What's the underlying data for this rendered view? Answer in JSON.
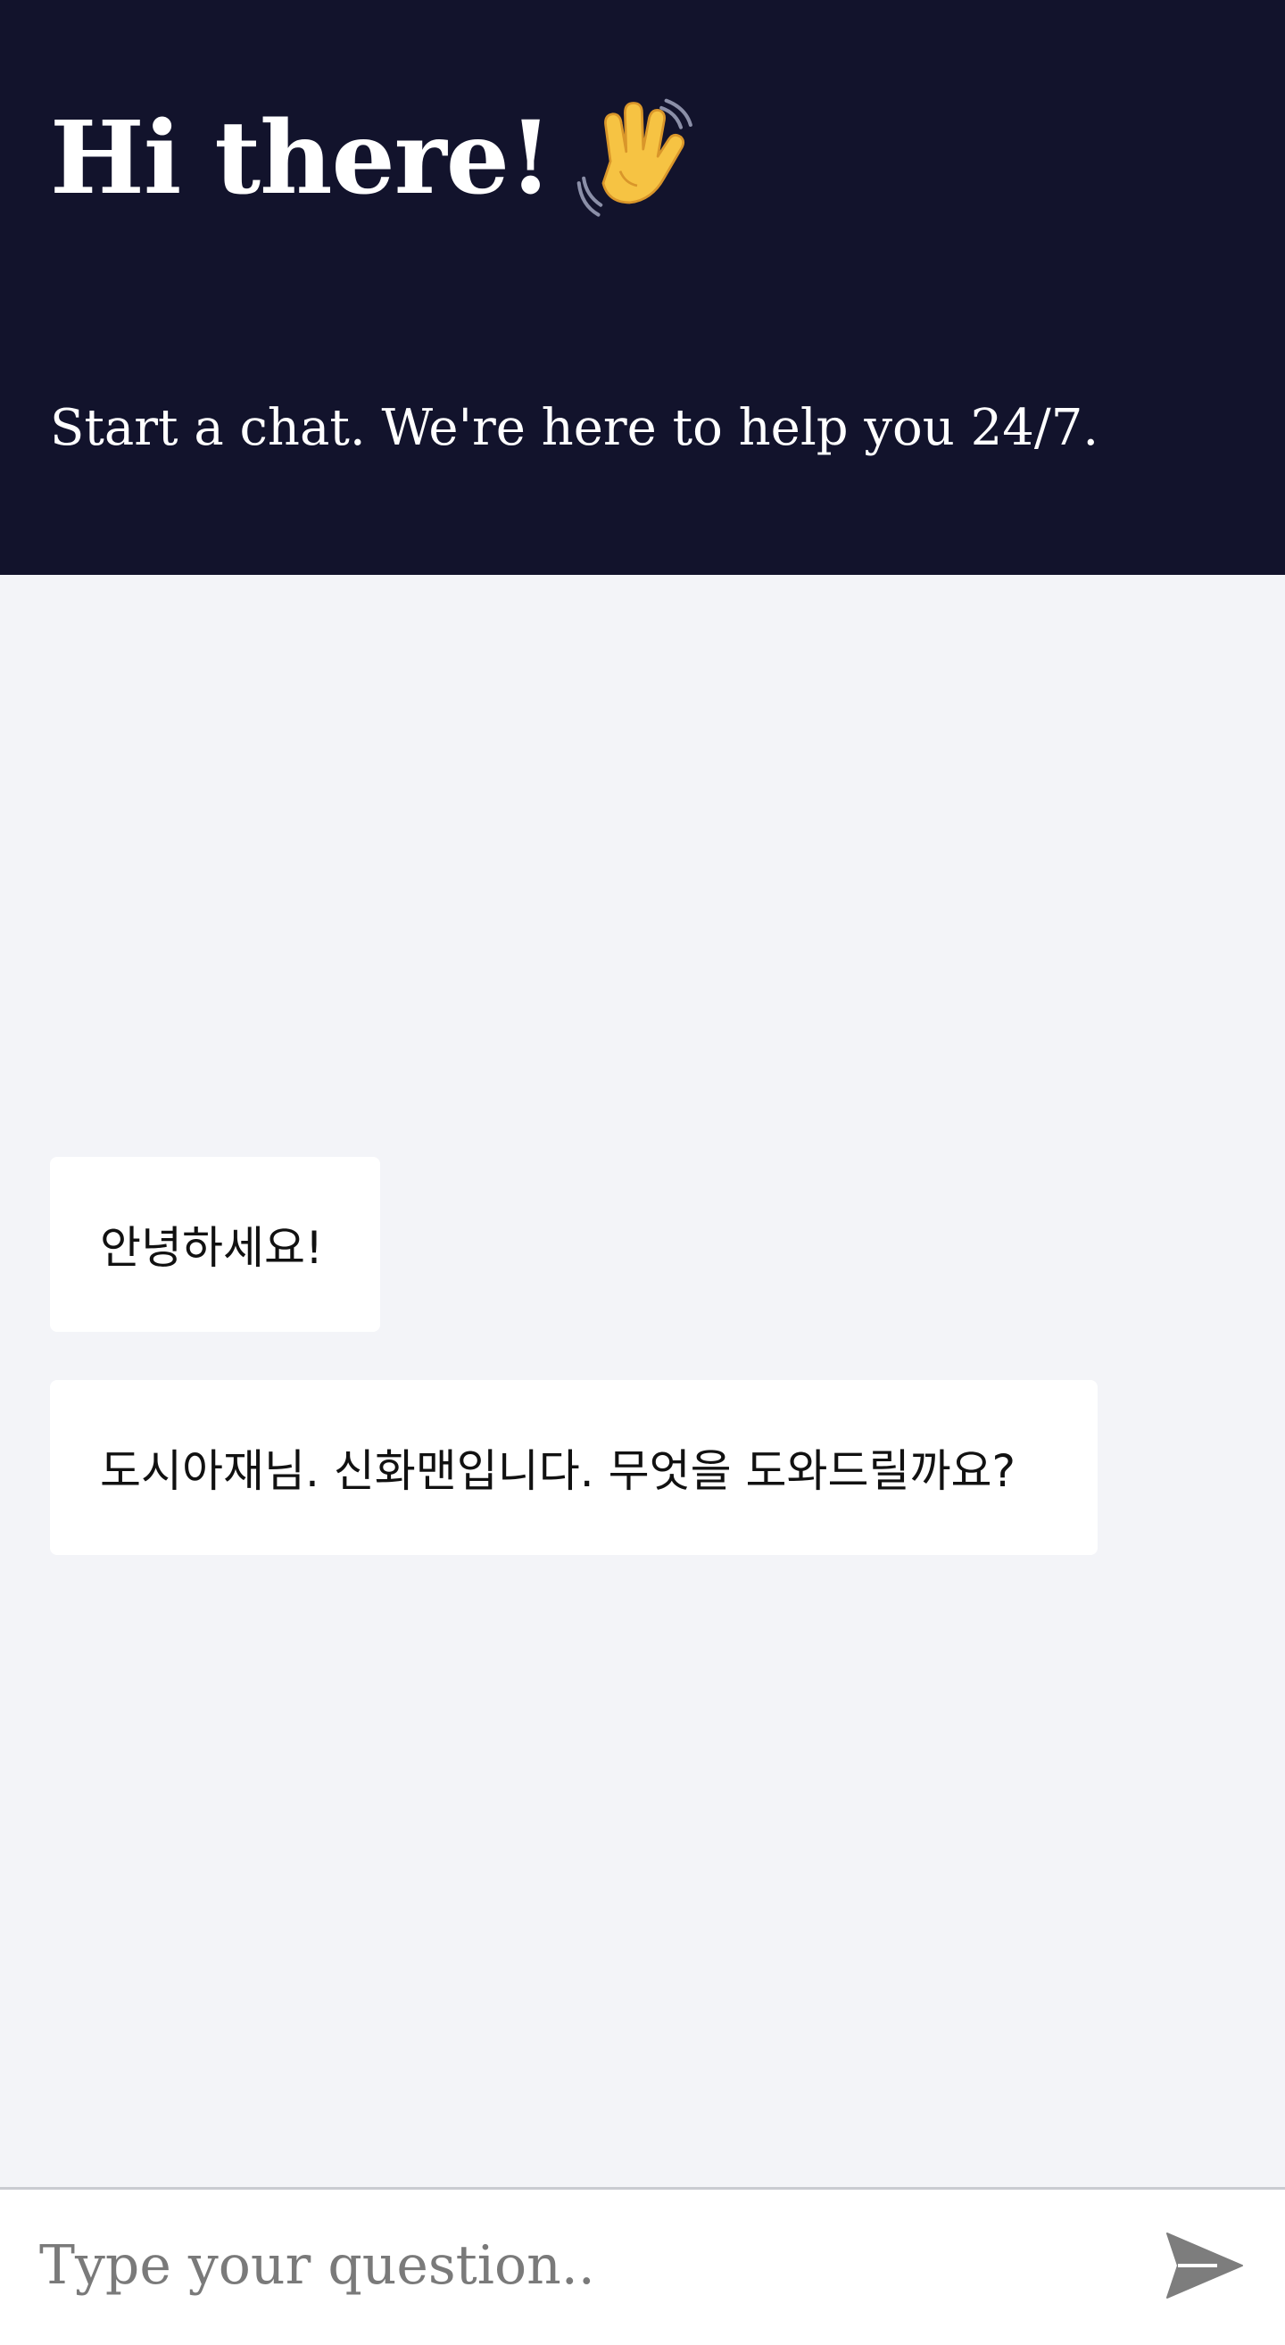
{
  "header": {
    "title": "Hi there!",
    "title_icon": "waving-hand-icon",
    "subtitle": "Start a chat. We're here to help you 24/7.",
    "background_color": "#12132c"
  },
  "chat": {
    "messages": [
      {
        "text": "안녕하세요!"
      },
      {
        "text": "도시아재님. 신화맨입니다. 무엇을 도와드릴까요?"
      }
    ],
    "background_color": "#f3f4f8",
    "bubble_color": "#ffffff"
  },
  "composer": {
    "placeholder": "Type your question..",
    "value": "",
    "send_icon": "send-icon",
    "send_icon_color": "#7d7d7d"
  }
}
